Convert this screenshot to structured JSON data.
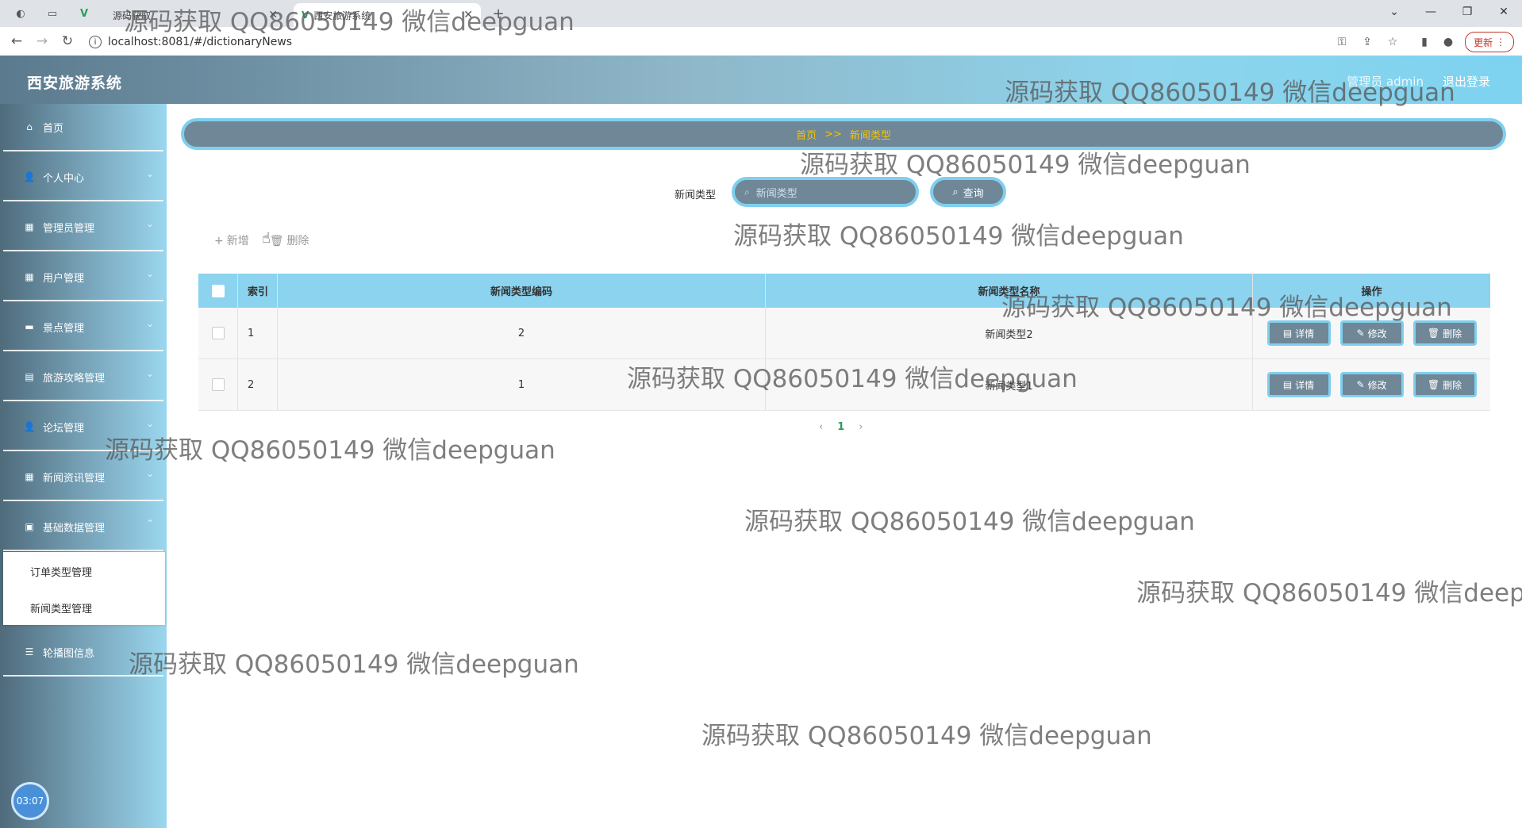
{
  "browser": {
    "tabs": [
      {
        "title": "源码获取",
        "active": false
      },
      {
        "title": "西安旅游系统",
        "active": true
      }
    ],
    "url": "localhost:8081/#/dictionaryNews",
    "update_label": "更新"
  },
  "header": {
    "title": "西安旅游系统",
    "user_label": "管理员 admin",
    "logout_label": "退出登录"
  },
  "sidebar": {
    "items": [
      {
        "label": "首页",
        "icon": "home-icon"
      },
      {
        "label": "个人中心",
        "icon": "user-icon"
      },
      {
        "label": "管理员管理",
        "icon": "grid-icon"
      },
      {
        "label": "用户管理",
        "icon": "grid-icon"
      },
      {
        "label": "景点管理",
        "icon": "chat-icon"
      },
      {
        "label": "旅游攻略管理",
        "icon": "document-icon"
      },
      {
        "label": "论坛管理",
        "icon": "user-icon"
      },
      {
        "label": "新闻资讯管理",
        "icon": "grid-icon"
      },
      {
        "label": "基础数据管理",
        "icon": "briefcase-icon"
      }
    ],
    "submenu": [
      "订单类型管理",
      "新闻类型管理"
    ],
    "last_item": {
      "label": "轮播图信息",
      "icon": "list-icon"
    },
    "clock": "03:07"
  },
  "breadcrumb": {
    "home": "首页",
    "separator": ">>",
    "current": "新闻类型"
  },
  "search": {
    "label": "新闻类型",
    "placeholder": "新闻类型",
    "button_label": "查询"
  },
  "actions": {
    "add_label": "新增",
    "delete_label": "删除"
  },
  "table": {
    "headers": {
      "index": "索引",
      "code": "新闻类型编码",
      "name": "新闻类型名称",
      "ops": "操作"
    },
    "rows": [
      {
        "index": "1",
        "code": "2",
        "name": "新闻类型2"
      },
      {
        "index": "2",
        "code": "1",
        "name": "新闻类型1"
      }
    ],
    "row_actions": {
      "detail": "详情",
      "edit": "修改",
      "delete": "删除"
    }
  },
  "pagination": {
    "prev": "‹",
    "current": "1",
    "next": "›"
  },
  "watermark_text": "源码获取 QQ86050149 微信deepguan",
  "colors": {
    "accent": "#7fcfee",
    "button_bg": "#6f8797",
    "breadcrumb_text": "#f5c400",
    "table_header": "#8bd3ef"
  }
}
